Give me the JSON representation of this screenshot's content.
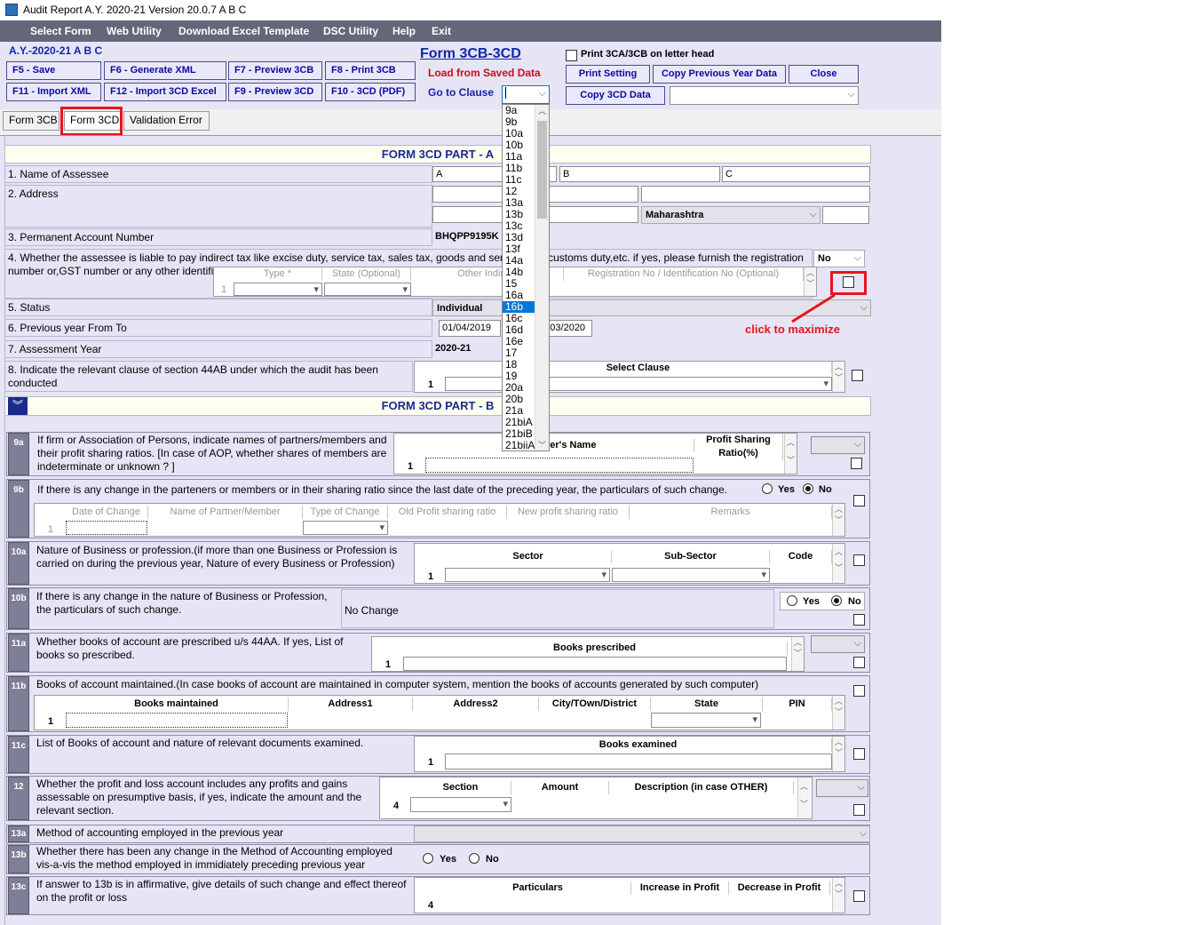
{
  "window": {
    "title": "Audit Report A.Y. 2020-21 Version 20.0.7 A B C"
  },
  "menu": [
    "Select Form",
    "Web Utility",
    "Download Excel Template",
    "DSC Utility",
    "Help",
    "Exit"
  ],
  "header": {
    "ay_label": "A.Y.-2020-21 A B C",
    "form_title": "Form 3CB-3CD",
    "load_saved": "Load from Saved Data",
    "goto_clause": "Go to Clause",
    "print_letterhead": "Print 3CA/3CB on letter head"
  },
  "toolbar": {
    "f5": "F5 - Save",
    "f6": "F6 - Generate XML",
    "f7": "F7 - Preview 3CB",
    "f8": "F8   - Print 3CB",
    "f11": "F11 - Import XML",
    "f12": "F12 - Import 3CD Excel",
    "f9": "F9 - Preview 3CD",
    "f10": "F10 - 3CD (PDF)",
    "print_setting": "Print Setting",
    "copy_prev": "Copy Previous Year Data",
    "close": "Close",
    "copy_3cd": "Copy 3CD Data"
  },
  "tabs": [
    "Form 3CB",
    "Form 3CD",
    "Validation Error"
  ],
  "part_a": {
    "title": "FORM 3CD PART - A",
    "q1": "1. Name of Assessee",
    "name_a": "A",
    "name_b": "B",
    "name_c": "C",
    "q2": "2. Address",
    "state": "Maharashtra",
    "q3": "3. Permanent Account Number",
    "pan": "BHQPP9195K",
    "q4": "4. Whether the assessee is liable to pay indirect tax like excise duty, service tax, sales tax, goods and services tax,customs duty,etc. if yes, please furnish the registration number or,GST number or any other identification number allotted for the same",
    "q4_value": "No",
    "q4_cols": [
      "Type *",
      "State (Optional)",
      "Other Indirect",
      "Registration No / Identification No (Optional)"
    ],
    "q5": "5. Status",
    "status": "Individual",
    "q6": "6. Previous year From To",
    "from": "01/04/2019",
    "to": "31/03/2020",
    "q7": "7. Assessment Year",
    "ay": "2020-21",
    "q8": "8. Indicate the relevant clause of section 44AB under which the audit has been conducted",
    "q8_col": "Select Clause"
  },
  "annotation": "click to maximize",
  "part_b": {
    "title": "FORM 3CD PART - B",
    "q9a": "If firm or Association of Persons, indicate names of partners/members and their profit sharing ratios.  [In case of AOP, whether shares of members are indeterminate or unknown ? ]",
    "q9a_cols": [
      "Member's Name",
      "Profit Sharing Ratio(%)"
    ],
    "q9b": "If there is any change in the parteners or members or in their sharing ratio since the last date of the preceding year, the particulars of such change.",
    "q9b_cols": [
      "Date of Change",
      "Name of Partner/Member",
      "Type of Change",
      "Old Profit sharing ratio",
      "New profit sharing ratio",
      "Remarks"
    ],
    "q10a": "Nature of Business or profession.(if more than one Business or Profession is carried on during the previous year, Nature of every Business or Profession)",
    "q10a_cols": [
      "Sector",
      "Sub-Sector",
      "Code"
    ],
    "q10b": "If there is any change in the nature of Business or Profession, the particulars of such change.",
    "q10b_value": "No Change",
    "q11a": "Whether books of account are prescribed u/s 44AA. If yes, List of books so prescribed.",
    "q11a_col": "Books prescribed",
    "q11b": "Books of account maintained.(In case books of account are maintained in computer system, mention the books of accounts generated by such computer)",
    "q11b_cols": [
      "Books maintained",
      "Address1",
      "Address2",
      "City/TOwn/District",
      "State",
      "PIN"
    ],
    "q11c": "List of Books of account and nature of relevant documents examined.",
    "q11c_col": "Books examined",
    "q12": "Whether the profit and loss account includes any profits and gains assessable on presumptive basis, if yes, indicate the amount and the relevant section.",
    "q12_cols": [
      "Section",
      "Amount",
      "Description (in case OTHER)"
    ],
    "q13a": "Method of accounting employed in the previous year",
    "q13b": "Whether there has been any change in the Method of Accounting employed vis-a-vis the method employed in immidiately preceding previous year",
    "q13c": "If answer to 13b is in affirmative, give details of such change and effect thereof on the profit or loss",
    "q13c_cols": [
      "Particulars",
      "Increase in Profit",
      "Decrease in Profit"
    ],
    "yes": "Yes",
    "no": "No",
    "row1": "1",
    "row4": "4"
  },
  "badges": [
    "9a",
    "9b",
    "10a",
    "10b",
    "11a",
    "11b",
    "11c",
    "12",
    "13a",
    "13b",
    "13c"
  ],
  "clause_options": [
    "9a",
    "9b",
    "10a",
    "10b",
    "11a",
    "11b",
    "11c",
    "12",
    "13a",
    "13b",
    "13c",
    "13d",
    "13f",
    "14a",
    "14b",
    "15",
    "16a",
    "16b",
    "16c",
    "16d",
    "16e",
    "17",
    "18",
    "19",
    "20a",
    "20b",
    "21a",
    "21biA",
    "21biB",
    "21biiA"
  ],
  "clause_selected": "16b"
}
